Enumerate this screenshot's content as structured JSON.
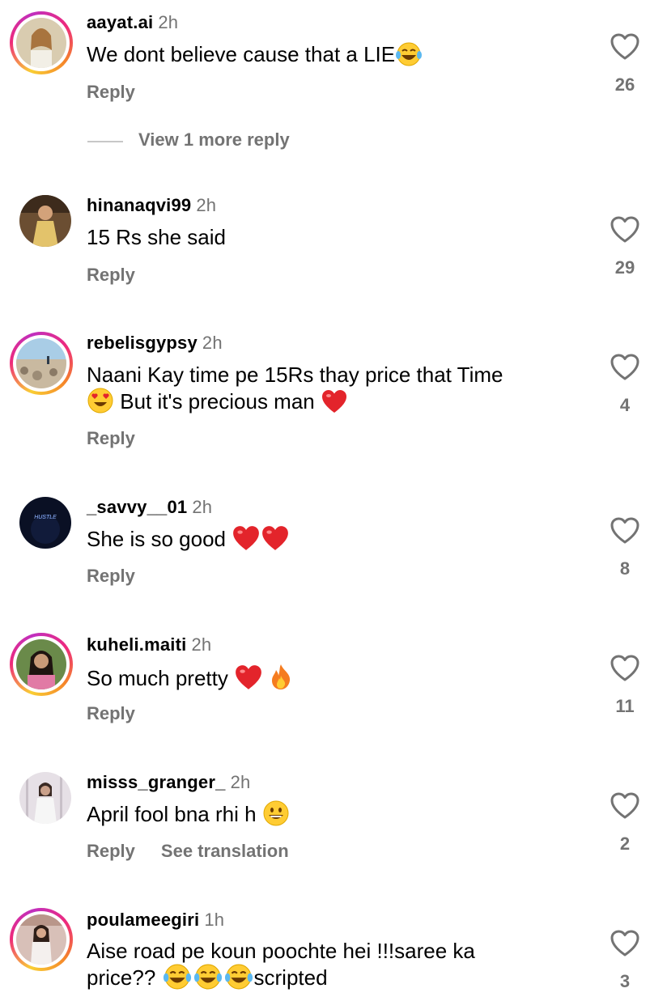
{
  "actions": {
    "reply": "Reply",
    "see_translation": "See translation",
    "view_more_replies": "View 1 more reply"
  },
  "comments": [
    {
      "username": "aayat.ai",
      "time": "2h",
      "text": "We dont believe cause that a LIE",
      "likes": "26",
      "story_ring": true,
      "avatar_color": "#c8b89a"
    },
    {
      "username": "hinanaqvi99",
      "time": "2h",
      "text": "15 Rs she said",
      "likes": "29",
      "story_ring": false,
      "avatar_color": "#7a5a3a"
    },
    {
      "username": "rebelisgypsy",
      "time": "2h",
      "text_line1": "Naani Kay time pe 15Rs thay price that Time",
      "text_line2": "But it's precious man",
      "likes": "4",
      "story_ring": true,
      "avatar_color": "#9cc0d8"
    },
    {
      "username": "_savvy__01",
      "time": "2h",
      "text": "She is so good",
      "likes": "8",
      "story_ring": false,
      "avatar_color": "#0c1326",
      "avatar_text": "HUSTLE"
    },
    {
      "username": "kuheli.maiti",
      "time": "2h",
      "text": "So much pretty",
      "likes": "11",
      "story_ring": true,
      "avatar_color": "#5a7a3a"
    },
    {
      "username": "misss_granger_",
      "time": "2h",
      "text": "April fool bna rhi h",
      "likes": "2",
      "story_ring": false,
      "avatar_color": "#d8d2d8"
    },
    {
      "username": "poulameegiri",
      "time": "1h",
      "text_line1": "Aise road pe koun poochte hei !!!saree ka",
      "text_line2_a": "price??",
      "text_line2_b": "scripted",
      "likes": "3",
      "story_ring": true,
      "avatar_color": "#c9a7a0"
    }
  ]
}
